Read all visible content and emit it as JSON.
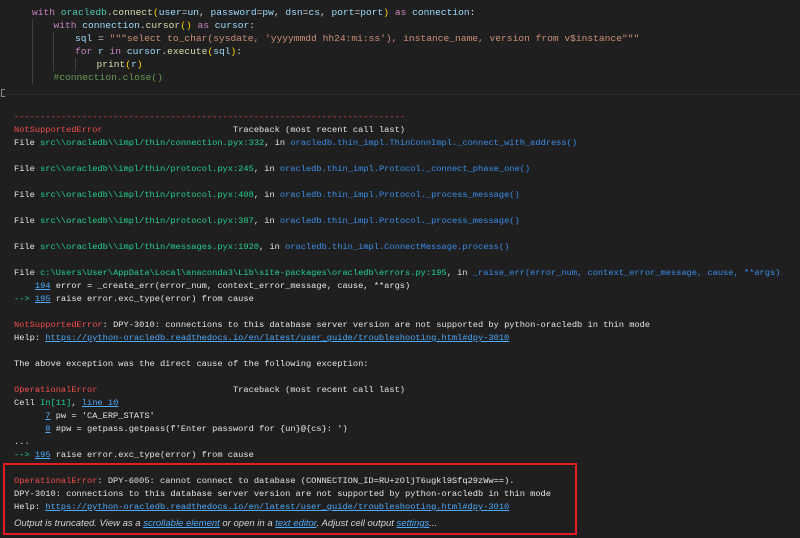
{
  "code_cell": {
    "lines": [
      {
        "indent": 0,
        "segs": [
          [
            "with ",
            "kw"
          ],
          [
            "oracledb",
            "mod"
          ],
          [
            ".",
            "plain"
          ],
          [
            "connect",
            "fn"
          ],
          [
            "(",
            "paren"
          ],
          [
            "user",
            "var"
          ],
          [
            "=",
            "plain"
          ],
          [
            "un",
            "var"
          ],
          [
            ", ",
            "plain"
          ],
          [
            "password",
            "var"
          ],
          [
            "=",
            "plain"
          ],
          [
            "pw",
            "var"
          ],
          [
            ", ",
            "plain"
          ],
          [
            "dsn",
            "var"
          ],
          [
            "=",
            "plain"
          ],
          [
            "cs",
            "var"
          ],
          [
            ", ",
            "plain"
          ],
          [
            "port",
            "var"
          ],
          [
            "=",
            "plain"
          ],
          [
            "port",
            "var"
          ],
          [
            ")",
            "paren"
          ],
          [
            " as ",
            "kw"
          ],
          [
            "connection",
            "var"
          ],
          [
            ":",
            "plain"
          ]
        ]
      },
      {
        "indent": 1,
        "segs": [
          [
            "with ",
            "kw"
          ],
          [
            "connection",
            "var"
          ],
          [
            ".",
            "plain"
          ],
          [
            "cursor",
            "fn"
          ],
          [
            "()",
            "paren"
          ],
          [
            " as ",
            "kw"
          ],
          [
            "cursor",
            "var"
          ],
          [
            ":",
            "plain"
          ]
        ]
      },
      {
        "indent": 2,
        "segs": [
          [
            "sql",
            "var"
          ],
          [
            " = ",
            "plain"
          ],
          [
            "\"\"\"select to_char(sysdate, 'yyyymmdd hh24:mi:ss'), instance_name, version from v$instance\"\"\"",
            "str"
          ]
        ]
      },
      {
        "indent": 2,
        "segs": [
          [
            "for ",
            "kw"
          ],
          [
            "r",
            "var"
          ],
          [
            " in ",
            "kw"
          ],
          [
            "cursor",
            "var"
          ],
          [
            ".",
            "plain"
          ],
          [
            "execute",
            "fn"
          ],
          [
            "(",
            "paren"
          ],
          [
            "sql",
            "var"
          ],
          [
            ")",
            "paren"
          ],
          [
            ":",
            "plain"
          ]
        ]
      },
      {
        "indent": 3,
        "segs": [
          [
            "print",
            "fn"
          ],
          [
            "(",
            "paren"
          ],
          [
            "r",
            "var"
          ],
          [
            ")",
            "paren"
          ]
        ]
      },
      {
        "indent": 1,
        "segs": [
          [
            "#connection.close()",
            "com"
          ]
        ]
      }
    ]
  },
  "output": {
    "lines": [
      [
        [
          "---------------------------------------------------------------------------",
          "dash"
        ]
      ],
      [
        [
          "NotSupportedError",
          "err"
        ],
        [
          "                         Traceback (most recent call last)",
          "white"
        ]
      ],
      [
        [
          "File ",
          "white"
        ],
        [
          "src\\\\oracledb\\\\impl/thin/connection.pyx:332",
          "path"
        ],
        [
          ", in ",
          "white"
        ],
        [
          "oracledb.thin_impl.ThinConnImpl._connect_with_address()",
          "func"
        ]
      ],
      [],
      [
        [
          "File ",
          "white"
        ],
        [
          "src\\\\oracledb\\\\impl/thin/protocol.pyx:245",
          "path"
        ],
        [
          ", in ",
          "white"
        ],
        [
          "oracledb.thin_impl.Protocol._connect_phase_one()",
          "func"
        ]
      ],
      [],
      [
        [
          "File ",
          "white"
        ],
        [
          "src\\\\oracledb\\\\impl/thin/protocol.pyx:408",
          "path"
        ],
        [
          ", in ",
          "white"
        ],
        [
          "oracledb.thin_impl.Protocol._process_message()",
          "func"
        ]
      ],
      [],
      [
        [
          "File ",
          "white"
        ],
        [
          "src\\\\oracledb\\\\impl/thin/protocol.pyx:387",
          "path"
        ],
        [
          ", in ",
          "white"
        ],
        [
          "oracledb.thin_impl.Protocol._process_message()",
          "func"
        ]
      ],
      [],
      [
        [
          "File ",
          "white"
        ],
        [
          "src\\\\oracledb\\\\impl/thin/messages.pyx:1920",
          "path"
        ],
        [
          ", in ",
          "white"
        ],
        [
          "oracledb.thin_impl.ConnectMessage.process()",
          "func"
        ]
      ],
      [],
      [
        [
          "File ",
          "white"
        ],
        [
          "c:\\Users\\User\\AppData\\Local\\anaconda3\\Lib\\site-packages\\oracledb\\errors.py:195",
          "path"
        ],
        [
          ", in ",
          "white"
        ],
        [
          "_raise_err(error_num, context_error_message, cause, **args)",
          "func"
        ]
      ],
      [
        [
          "    ",
          "white"
        ],
        [
          "194",
          "link"
        ],
        [
          " error = _create_err(error_num, context_error_message, cause, **args)",
          "white"
        ]
      ],
      [
        [
          "--> ",
          "green"
        ],
        [
          "195",
          "link"
        ],
        [
          " raise error.exc_type(error) from cause",
          "white"
        ]
      ],
      [],
      [
        [
          "NotSupportedError",
          "err"
        ],
        [
          ": DPY-3010: connections to this database server version are not supported by python-oracledb in thin mode",
          "white"
        ]
      ],
      [
        [
          "Help: ",
          "white"
        ],
        [
          "https://python-oracledb.readthedocs.io/en/latest/user_guide/troubleshooting.html#dpy-3010",
          "link"
        ]
      ],
      [],
      [
        [
          "The above exception was the direct cause of the following exception:",
          "white"
        ]
      ],
      [],
      [
        [
          "OperationalError",
          "err"
        ],
        [
          "                          Traceback (most recent call last)",
          "white"
        ]
      ],
      [
        [
          "Cell ",
          "white"
        ],
        [
          "In[11]",
          "green"
        ],
        [
          ", ",
          "white"
        ],
        [
          "line 10",
          "link"
        ]
      ],
      [
        [
          "      ",
          "white"
        ],
        [
          "7",
          "link"
        ],
        [
          " pw = 'CA_ERP_STATS'",
          "white"
        ]
      ],
      [
        [
          "      ",
          "white"
        ],
        [
          "8",
          "link"
        ],
        [
          " #pw = getpass.getpass(f'Enter password for {un}@{cs}: ')",
          "white"
        ]
      ],
      [
        [
          "...",
          "white"
        ]
      ],
      [
        [
          "--> ",
          "green"
        ],
        [
          "195",
          "link"
        ],
        [
          " raise error.exc_type(error) from cause",
          "white"
        ]
      ],
      [],
      [
        [
          "OperationalError",
          "err"
        ],
        [
          ": DPY-6005: cannot connect to database (CONNECTION_ID=RU+zOljT6ugkl9Sfq29zWw==).",
          "white"
        ]
      ],
      [
        [
          "DPY-3010: connections to this database server version are not supported by python-oracledb in thin mode",
          "white"
        ]
      ],
      [
        [
          "Help: ",
          "white"
        ],
        [
          "https://python-oracledb.readthedocs.io/en/latest/user_guide/troubleshooting.html#dpy-3010",
          "link"
        ]
      ]
    ],
    "truncated": [
      [
        "Output is truncated. View as a ",
        "plain"
      ],
      [
        "scrollable element",
        "link"
      ],
      [
        " or open in a ",
        "plain"
      ],
      [
        "text editor",
        "link"
      ],
      [
        ". Adjust cell output ",
        "plain"
      ],
      [
        "settings",
        "link"
      ],
      [
        "...",
        "plain"
      ]
    ]
  },
  "colors": {
    "error": "#f14c4c",
    "highlight_box": "#e51c23",
    "link": "#4daafc",
    "background": "#1f1f1f"
  }
}
